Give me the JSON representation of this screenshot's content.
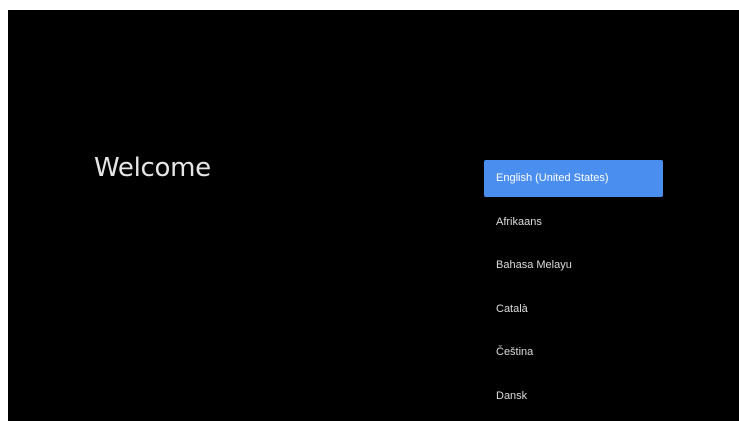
{
  "welcome": {
    "title": "Welcome"
  },
  "languages": {
    "selected_index": 0,
    "items": [
      {
        "label": "English (United States)"
      },
      {
        "label": "Afrikaans"
      },
      {
        "label": "Bahasa Melayu"
      },
      {
        "label": "Català"
      },
      {
        "label": "Čeština"
      },
      {
        "label": "Dansk"
      }
    ]
  },
  "colors": {
    "background": "#000000",
    "selection": "#4a8ef0",
    "text": "#dcdcdc"
  }
}
